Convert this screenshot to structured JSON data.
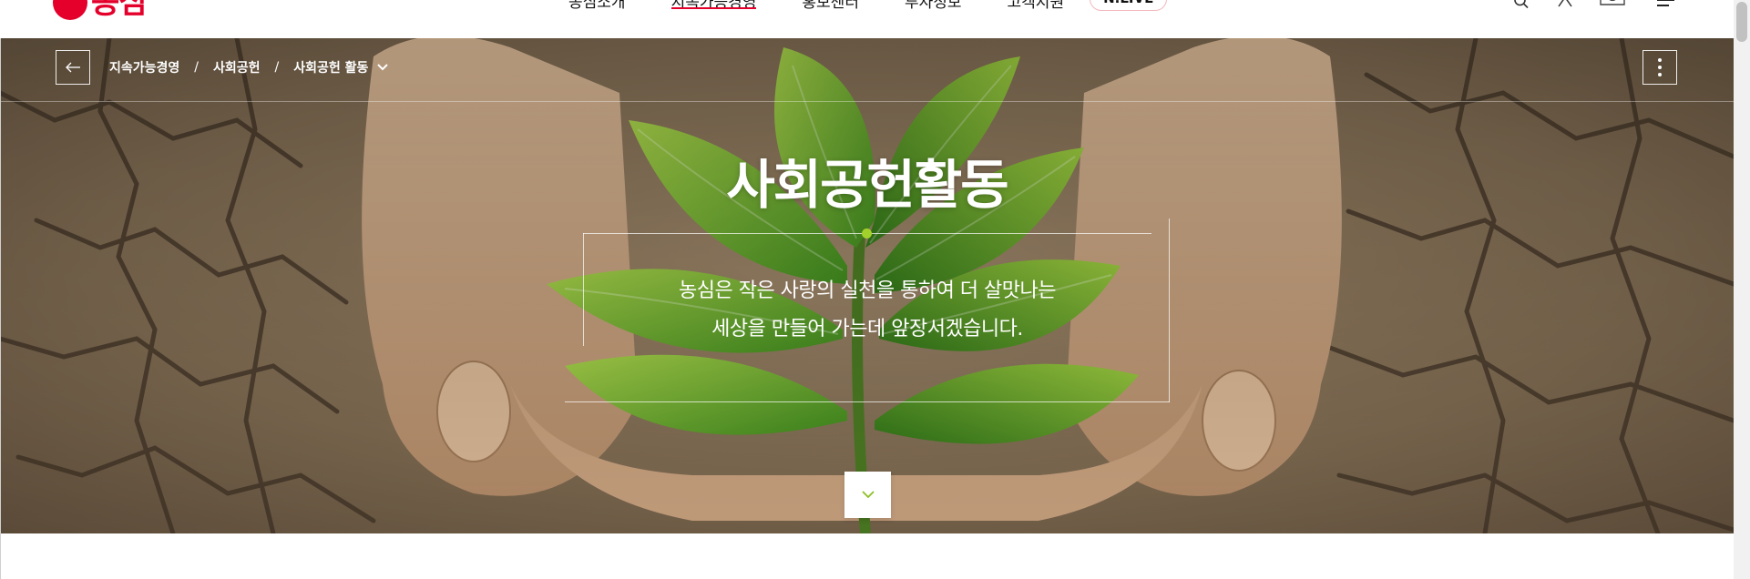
{
  "header": {
    "logo_text": "농심",
    "nav": [
      {
        "label": "농심소개",
        "active": false
      },
      {
        "label": "지속가능경영",
        "active": true
      },
      {
        "label": "홍보센터",
        "active": false
      },
      {
        "label": "투자정보",
        "active": false
      },
      {
        "label": "고객지원",
        "active": false
      }
    ],
    "live_label": "N.LIVE",
    "utility_icons": [
      "search-icon",
      "user-icon",
      "chat-icon",
      "menu-icon"
    ]
  },
  "location": {
    "crumbs": [
      "지속가능경영",
      "사회공헌",
      "사회공헌 활동"
    ],
    "separator": "/"
  },
  "hero": {
    "title": "사회공헌활동",
    "desc_line1": "농심은 작은 사랑의 실천을 통하여 더 살맛나는",
    "desc_line2": "세상을 만들어 가는데 앞장서겠습니다."
  },
  "colors": {
    "brand_red": "#e4002b",
    "accent_green": "#a3d12c"
  }
}
